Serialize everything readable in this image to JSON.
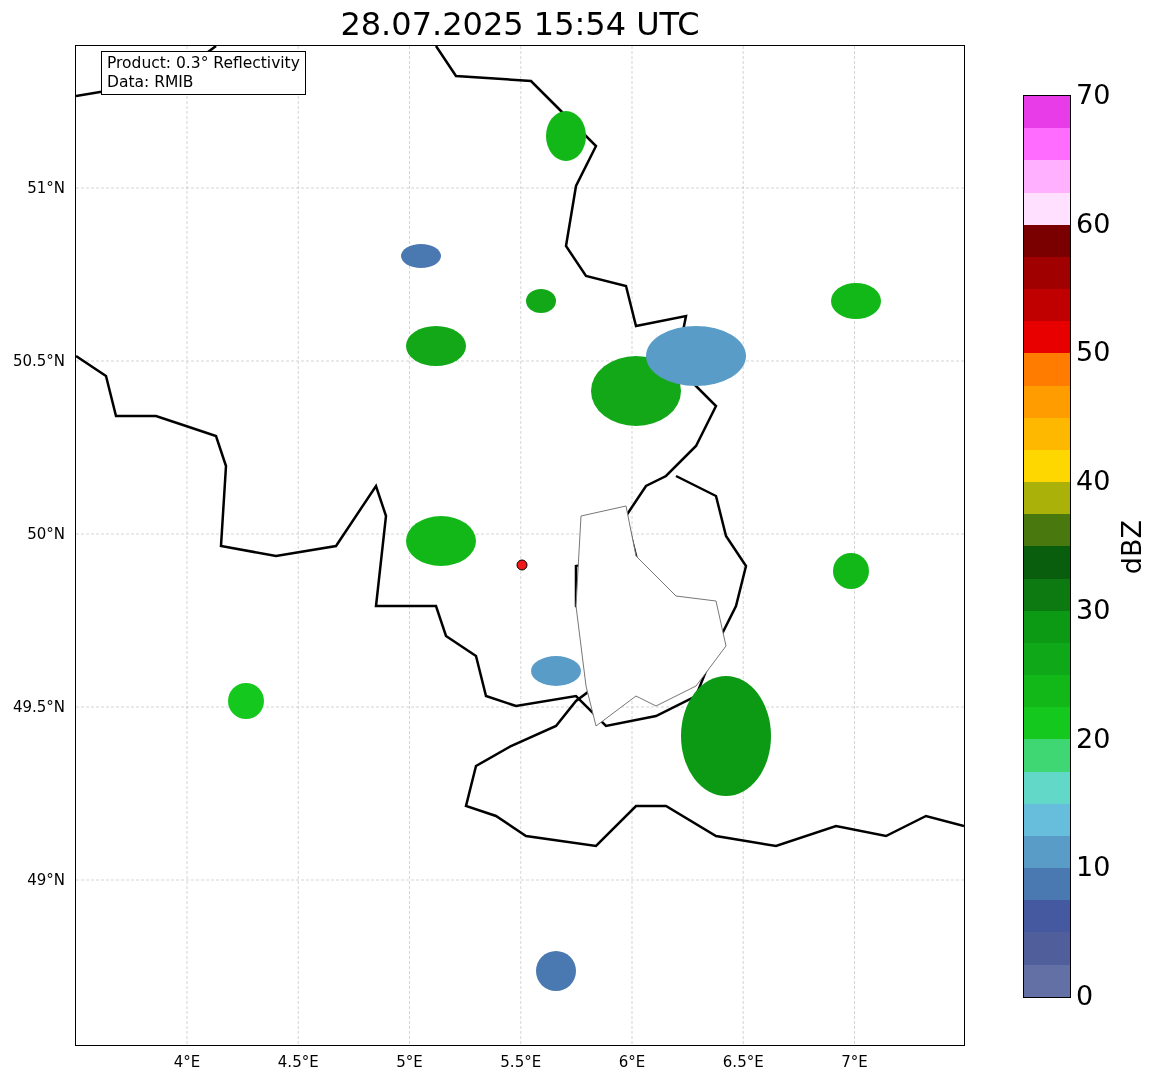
{
  "title": "28.07.2025 15:54 UTC",
  "info_box": [
    "Product: 0.3° Reflectivity",
    "Data: RMIB"
  ],
  "map": {
    "xticks": [
      "4°E",
      "4.5°E",
      "5°E",
      "5.5°E",
      "6°E",
      "6.5°E",
      "7°E"
    ],
    "yticks": [
      "51°N",
      "50.5°N",
      "50°N",
      "49.5°N",
      "49°N"
    ]
  },
  "colorbar": {
    "label": "dBZ",
    "ticks": [
      "70",
      "60",
      "50",
      "40",
      "30",
      "20",
      "10",
      "0"
    ],
    "bins": [
      {
        "color": "#e83ce8"
      },
      {
        "color": "#ff6cff"
      },
      {
        "color": "#ffb0ff"
      },
      {
        "color": "#ffe0ff"
      },
      {
        "color": "#7a0000"
      },
      {
        "color": "#a00000"
      },
      {
        "color": "#c00000"
      },
      {
        "color": "#e80000"
      },
      {
        "color": "#ff7c00"
      },
      {
        "color": "#ff9c00"
      },
      {
        "color": "#ffb800"
      },
      {
        "color": "#ffd700"
      },
      {
        "color": "#aab20a"
      },
      {
        "color": "#48780e"
      },
      {
        "color": "#085e0c"
      },
      {
        "color": "#0c7a10"
      },
      {
        "color": "#0c9a14"
      },
      {
        "color": "#0ea818"
      },
      {
        "color": "#11b818"
      },
      {
        "color": "#14c81e"
      },
      {
        "color": "#3fd674"
      },
      {
        "color": "#62d8c8"
      },
      {
        "color": "#66bedc"
      },
      {
        "color": "#5a9cc8"
      },
      {
        "color": "#4a78b0"
      },
      {
        "color": "#44599f"
      },
      {
        "color": "#505f9c"
      },
      {
        "color": "#6270a6"
      }
    ]
  }
}
